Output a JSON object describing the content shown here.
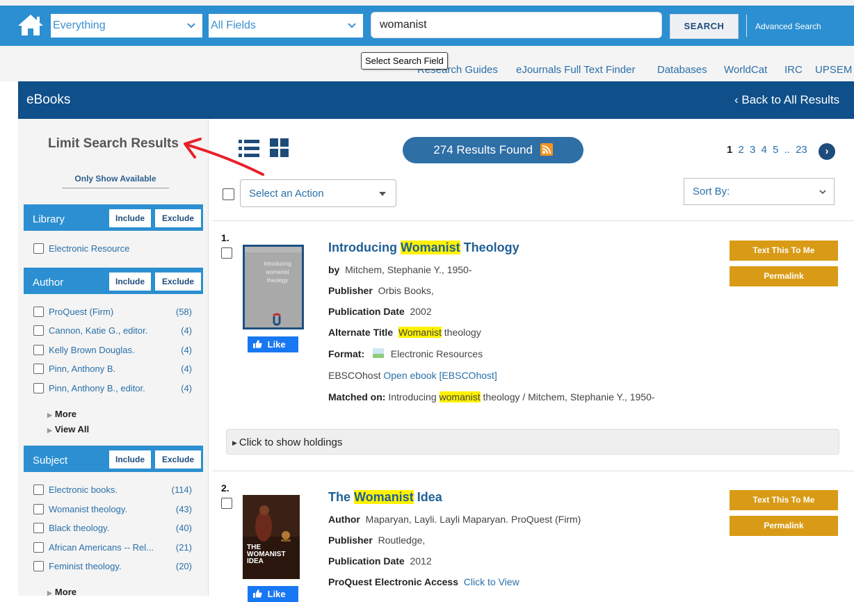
{
  "search": {
    "scope_value": "Everything",
    "field_value": "All Fields",
    "query": "womanist",
    "button_label": "SEARCH",
    "advanced_label": "Advanced Search",
    "tooltip": "Select Search Field"
  },
  "utility_links": [
    "Research Guides",
    "eJournals Full Text Finder",
    "Databases",
    "WorldCat",
    "IRC",
    "UPSEM"
  ],
  "section": {
    "title": "eBooks",
    "back_label": "‹ Back to All Results"
  },
  "sidebar": {
    "title": "Limit Search Results",
    "only_available": "Only Show Available",
    "include_label": "Include",
    "exclude_label": "Exclude",
    "more_label": "More",
    "view_all_label": "View All",
    "library": {
      "title": "Library",
      "items": [
        {
          "label": "Electronic Resource",
          "count": ""
        }
      ]
    },
    "author": {
      "title": "Author",
      "items": [
        {
          "label": "ProQuest (Firm)",
          "count": "(58)"
        },
        {
          "label": "Cannon, Katie G., editor.",
          "count": "(4)"
        },
        {
          "label": "Kelly Brown Douglas.",
          "count": "(4)"
        },
        {
          "label": "Pinn, Anthony B.",
          "count": "(4)"
        },
        {
          "label": "Pinn, Anthony B., editor.",
          "count": "(4)"
        }
      ]
    },
    "subject": {
      "title": "Subject",
      "items": [
        {
          "label": "Electronic books.",
          "count": "(114)"
        },
        {
          "label": "Womanist theology.",
          "count": "(43)"
        },
        {
          "label": "Black theology.",
          "count": "(40)"
        },
        {
          "label": "African Americans -- Rel...",
          "count": "(21)"
        },
        {
          "label": "Feminist theology.",
          "count": "(20)"
        }
      ]
    }
  },
  "toolbar": {
    "results_found": "274 Results Found",
    "pages": [
      "1",
      "2",
      "3",
      "4",
      "5",
      "..",
      "23"
    ],
    "action_placeholder": "Select an Action",
    "sort_label": "Sort By:"
  },
  "results": [
    {
      "number": "1.",
      "title_pre": "Introducing ",
      "title_hl": "Womanist",
      "title_post": " Theology",
      "cover_text": "Introducing womanist theology",
      "by_label": "by",
      "by_value": "Mitchem, Stephanie Y., 1950-",
      "publisher_label": "Publisher",
      "publisher_value": "Orbis Books,",
      "date_label": "Publication Date",
      "date_value": "2002",
      "alt_label": "Alternate Title",
      "alt_hl": "Womanist",
      "alt_post": " theology",
      "format_label": "Format:",
      "format_value": "Electronic Resources",
      "ebsco_label": "EBSCOhost",
      "ebsco_link": "Open ebook [EBSCOhost]",
      "matched_label": "Matched on:",
      "matched_pre": "Introducing ",
      "matched_hl": "womanist",
      "matched_post": " theology / Mitchem, Stephanie Y., 1950-",
      "text_me": "Text This To Me",
      "permalink": "Permalink",
      "like": "Like",
      "holdings": "Click to show holdings"
    },
    {
      "number": "2.",
      "title_pre": "The ",
      "title_hl": "Womanist",
      "title_post": " Idea",
      "cover_text": "THE WOMANIST IDEA",
      "author_label": "Author",
      "author_value": "Maparyan, Layli. Layli Maparyan. ProQuest (Firm)",
      "publisher_label": "Publisher",
      "publisher_value": "Routledge,",
      "date_label": "Publication Date",
      "date_value": "2012",
      "access_label": "ProQuest Electronic Access",
      "access_link": "Click to View",
      "text_me": "Text This To Me",
      "permalink": "Permalink",
      "like": "Like"
    }
  ],
  "colors": {
    "top_bar": "#2b8fd1",
    "section_header": "#0f4f8a",
    "gold_button": "#d99b16",
    "highlight": "#fff200",
    "annotation_arrow": "#e8202a"
  }
}
